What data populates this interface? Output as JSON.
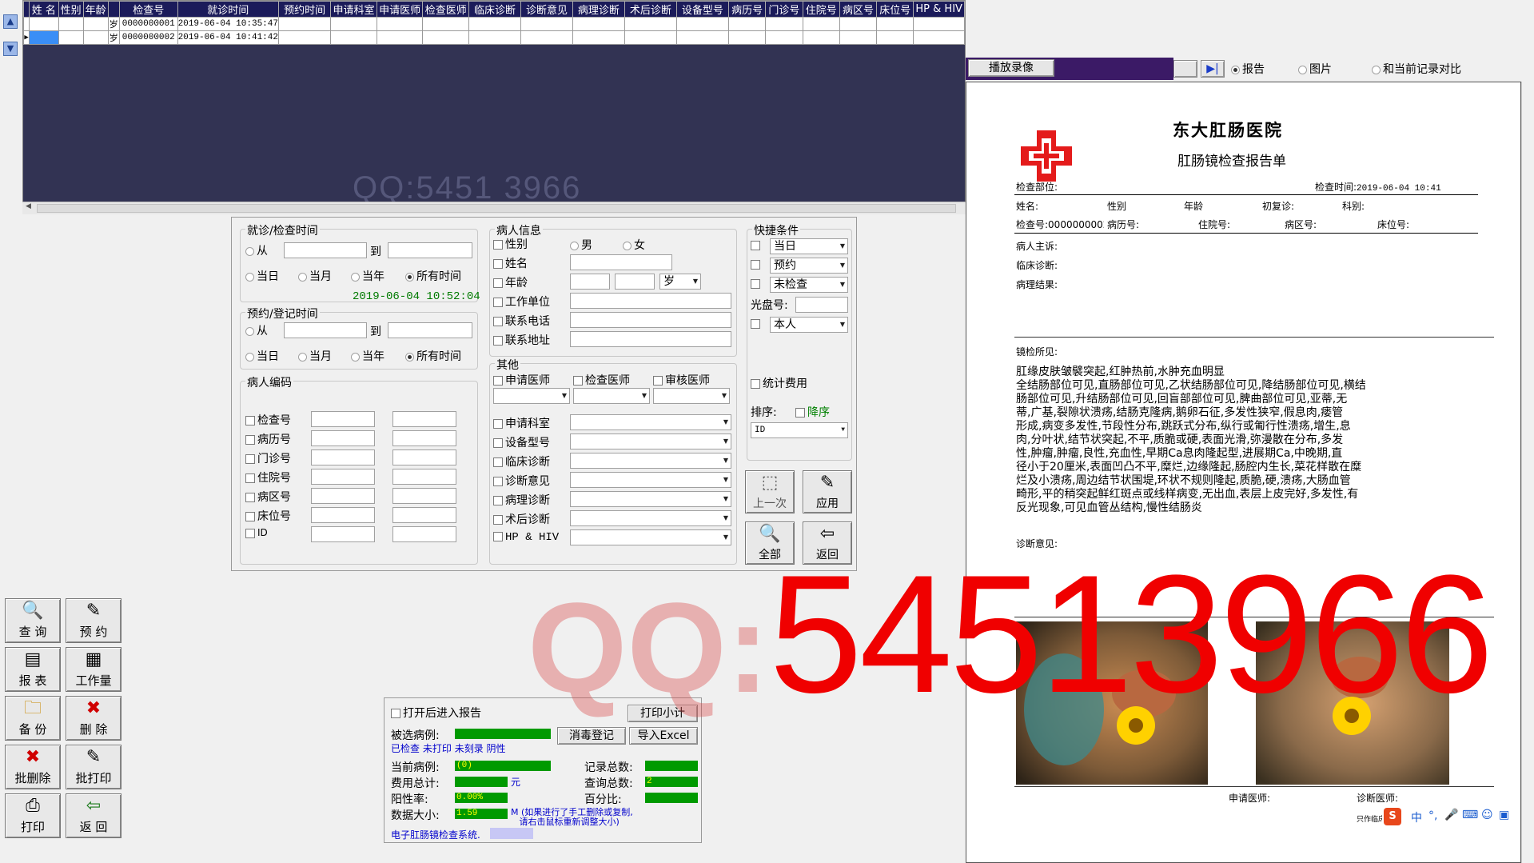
{
  "grid": {
    "headers": [
      "姓  名",
      "性别",
      "年龄",
      "",
      "检查号",
      "就诊时间",
      "预约时间",
      "申请科室",
      "申请医师",
      "检查医师",
      "临床诊断",
      "诊断意见",
      "病理诊断",
      "术后诊断",
      "设备型号",
      "病历号",
      "门诊号",
      "住院号",
      "病区号",
      "床位号",
      "HP & HIV"
    ],
    "rows": [
      [
        "",
        "",
        "",
        "岁",
        "0000000001",
        "2019-06-04 10:35:47"
      ],
      [
        "",
        "",
        "",
        "岁",
        "0000000002",
        "2019-06-04 10:41:42"
      ]
    ]
  },
  "watermark_small": "QQ:5451 3966",
  "watermark_big": {
    "prefix": "QQ:",
    "number": "54513966"
  },
  "visit_time": {
    "title": "就诊/检查时间",
    "from": "从",
    "to": "到",
    "radios": [
      "当日",
      "当月",
      "当年",
      "所有时间"
    ],
    "selected": 3,
    "timestamp": "2019-06-04 10:52:04"
  },
  "appt_time": {
    "title": "预约/登记时间",
    "from": "从",
    "to": "到",
    "radios": [
      "当日",
      "当月",
      "当年",
      "所有时间"
    ],
    "selected": 3
  },
  "patient_code": {
    "title": "病人编码",
    "items": [
      "检查号",
      "病历号",
      "门诊号",
      "住院号",
      "病区号",
      "床位号",
      "ID"
    ]
  },
  "patient_info": {
    "title": "病人信息",
    "gender_label": "性别",
    "male": "男",
    "female": "女",
    "name": "姓名",
    "age": "年龄",
    "age_unit": "岁",
    "work": "工作单位",
    "phone": "联系电话",
    "address": "联系地址"
  },
  "other": {
    "title": "其他",
    "doctors": [
      "申请医师",
      "检查医师",
      "审核医师"
    ],
    "items": [
      "申请科室",
      "设备型号",
      "临床诊断",
      "诊断意见",
      "病理诊断",
      "术后诊断",
      "HP & HIV"
    ]
  },
  "quick": {
    "title": "快捷条件",
    "combos": [
      "当日",
      "预约",
      "未检查"
    ],
    "disc_label": "光盘号:",
    "owner": "本人",
    "stat_fee": "统计费用",
    "sort_label": "排序:",
    "desc_label": "降序",
    "sort_value": "ID",
    "buttons": [
      "上一次",
      "应用",
      "全部",
      "返回"
    ]
  },
  "side_buttons": [
    {
      "label": "查 询",
      "icon": "🔍"
    },
    {
      "label": "预 约",
      "icon": "✎"
    },
    {
      "label": "报 表",
      "icon": "▤"
    },
    {
      "label": "工作量",
      "icon": "▦"
    },
    {
      "label": "备 份",
      "icon": "🗀"
    },
    {
      "label": "删 除",
      "icon": "✖"
    },
    {
      "label": "批删除",
      "icon": "✖"
    },
    {
      "label": "批打印",
      "icon": "✎"
    },
    {
      "label": "打印",
      "icon": "⎙"
    },
    {
      "label": "返 回",
      "icon": "⇦"
    }
  ],
  "stats": {
    "open_report": "打开后进入报告",
    "print_subtotal": "打印小计",
    "disinfect": "消毒登记",
    "export": "导入Excel",
    "selected_label": "被选病例:",
    "legend": [
      "已检查",
      "未打印",
      "未刻录",
      "阴性"
    ],
    "current_label": "当前病例:",
    "current_value": "(0)",
    "fee_label": "费用总计:",
    "fee_unit": "元",
    "positive_label": "阳性率:",
    "positive_value": "0.00%",
    "size_label": "数据大小:",
    "size_value": "1.59",
    "size_unit": "M",
    "size_note1": "(如果进行了手工删除或复制,",
    "size_note2": "请右击鼠标重新调整大小)",
    "records_label": "记录总数:",
    "query_label": "查询总数:",
    "query_value": "2",
    "percent_label": "百分比:",
    "system_name": "电子肛肠镜检查系统."
  },
  "viewer": {
    "play_button": "播放录像",
    "radios": [
      "报告",
      "图片",
      "和当前记录对比"
    ],
    "selected": 0
  },
  "report": {
    "hospital": "东大肛肠医院",
    "title": "肛肠镜检查报告单",
    "part_label": "检查部位:",
    "time_label": "检查时间:",
    "time_value": "2019-06-04 10:41",
    "row1": [
      "姓名:",
      "性别",
      "年龄",
      "初复诊:",
      "科别:"
    ],
    "row2": [
      "检查号:0000000002",
      "病历号:",
      "住院号:",
      "病区号:",
      "床位号:"
    ],
    "complaint": "病人主诉:",
    "clinical": "临床诊断:",
    "pathology": "病理结果:",
    "findings_label": "镜检所见:",
    "findings_lines": [
      "肛缘皮肤皱襞突起,红肿热前,水肿充血明显",
      "全结肠部位可见,直肠部位可见,乙状结肠部位可见,降结肠部位可见,横结",
      "肠部位可见,升结肠部位可见,回盲部部位可见,脾曲部位可见,亚蒂,无",
      "蒂,广基,裂隙状溃疡,结肠克隆病,鹅卵石征,多发性狭窄,假息肉,瘘管",
      "形成,病变多发性,节段性分布,跳跃式分布,纵行或匍行性溃疡,增生,息",
      "肉,分叶状,结节状突起,不平,质脆或硬,表面光滑,弥漫散在分布,多发",
      "性,肿瘤,肿瘤,良性,充血性,早期Ca息肉隆起型,进展期Ca,中晚期,直",
      "径小于20厘米,表面凹凸不平,糜烂,边缘隆起,肠腔内生长,菜花样散在糜",
      "烂及小溃疡,周边结节状围堤,环状不规则隆起,质脆,硬,溃疡,大肠血管",
      "畸形,平的稍突起鲜红斑点或线样病变,无出血,表层上皮完好,多发性,有",
      "反光现象,可见血管丛结构,慢性结肠炎"
    ],
    "opinion_label": "诊断意见:",
    "req_doctor": "申请医师:",
    "diag_doctor": "诊断医师:",
    "footer_small": "只作临床"
  },
  "ime": {
    "logo": "S",
    "lang": "中"
  }
}
